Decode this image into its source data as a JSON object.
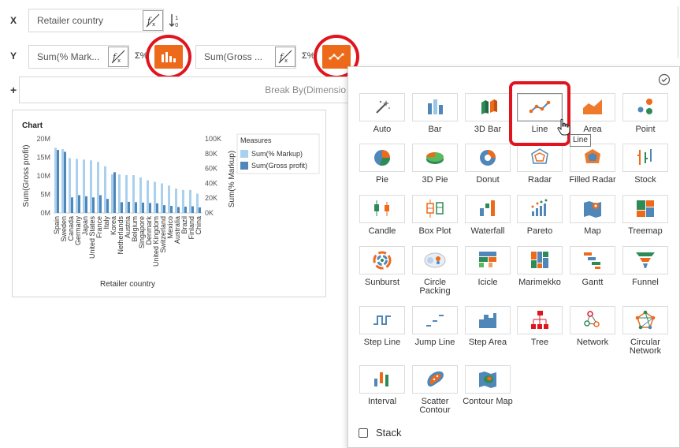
{
  "shelf": {
    "x_label": "X",
    "y_label": "Y",
    "plus_label": "+",
    "x_field": "Retailer country",
    "y_field_1": "Sum(% Mark...",
    "y_field_2": "Sum(Gross ...",
    "break_by_placeholder": "Break By(Dimensio",
    "sigma_label": "Σ%"
  },
  "chart": {
    "title": "Chart",
    "xlabel": "Retailer country",
    "legend_title": "Measures"
  },
  "chart_data": {
    "type": "bar",
    "title": "Chart",
    "xlabel": "Retailer country",
    "ylabel": "Sum(Gross profit)",
    "y2label": "Sum(% Markup)",
    "categories": [
      "Spain",
      "Sweden",
      "Canada",
      "Germany",
      "Japan",
      "United States",
      "France",
      "Italy",
      "Korea",
      "Netherlands",
      "Austria",
      "Belgium",
      "Singapore",
      "Denmark",
      "United Kingdom",
      "Switzerland",
      "Mexico",
      "Australia",
      "Brazil",
      "Finland",
      "China"
    ],
    "series": [
      {
        "name": "Sum(% Markup)",
        "axis": "right",
        "color": "#a9d1ef",
        "values": [
          88000,
          86000,
          74000,
          73000,
          72000,
          71000,
          69000,
          63000,
          52000,
          52000,
          51000,
          51000,
          48000,
          44000,
          42000,
          40000,
          37000,
          33000,
          31000,
          31000,
          26000
        ]
      },
      {
        "name": "Sum(Gross profit)",
        "axis": "left",
        "color": "#4f87b8",
        "values": [
          17000000,
          16500000,
          4200000,
          4800000,
          4500000,
          4200000,
          4800000,
          3800000,
          11000000,
          2900000,
          3000000,
          2900000,
          2800000,
          2700000,
          2600000,
          2100000,
          1900000,
          1600000,
          1700000,
          1800000,
          1500000
        ]
      }
    ],
    "ylim": [
      0,
      20000000
    ],
    "y_ticks": [
      "0M",
      "5M",
      "10M",
      "15M",
      "20M"
    ],
    "y2lim": [
      0,
      100000
    ],
    "y2_ticks": [
      "0K",
      "20K",
      "40K",
      "60K",
      "80K",
      "100K"
    ],
    "legend": "right",
    "grid": false
  },
  "picker": {
    "stack_label": "Stack",
    "tooltip": "Line",
    "charts": [
      {
        "label": "Auto",
        "icon": "magic-wand-icon"
      },
      {
        "label": "Bar",
        "icon": "bar-chart-icon"
      },
      {
        "label": "3D Bar",
        "icon": "bar-3d-icon"
      },
      {
        "label": "Line",
        "icon": "line-chart-icon"
      },
      {
        "label": "Area",
        "icon": "area-chart-icon"
      },
      {
        "label": "Point",
        "icon": "point-chart-icon"
      },
      {
        "label": "Pie",
        "icon": "pie-chart-icon"
      },
      {
        "label": "3D Pie",
        "icon": "pie-3d-icon"
      },
      {
        "label": "Donut",
        "icon": "donut-chart-icon"
      },
      {
        "label": "Radar",
        "icon": "radar-chart-icon"
      },
      {
        "label": "Filled Radar",
        "icon": "filled-radar-icon"
      },
      {
        "label": "Stock",
        "icon": "stock-chart-icon"
      },
      {
        "label": "Candle",
        "icon": "candle-chart-icon"
      },
      {
        "label": "Box Plot",
        "icon": "box-plot-icon"
      },
      {
        "label": "Waterfall",
        "icon": "waterfall-chart-icon"
      },
      {
        "label": "Pareto",
        "icon": "pareto-chart-icon"
      },
      {
        "label": "Map",
        "icon": "map-icon"
      },
      {
        "label": "Treemap",
        "icon": "treemap-icon"
      },
      {
        "label": "Sunburst",
        "icon": "sunburst-icon"
      },
      {
        "label": "Circle Packing",
        "icon": "circle-packing-icon"
      },
      {
        "label": "Icicle",
        "icon": "icicle-icon"
      },
      {
        "label": "Marimekko",
        "icon": "marimekko-icon"
      },
      {
        "label": "Gantt",
        "icon": "gantt-icon"
      },
      {
        "label": "Funnel",
        "icon": "funnel-icon"
      },
      {
        "label": "Step Line",
        "icon": "step-line-icon"
      },
      {
        "label": "Jump Line",
        "icon": "jump-line-icon"
      },
      {
        "label": "Step Area",
        "icon": "step-area-icon"
      },
      {
        "label": "Tree",
        "icon": "tree-chart-icon"
      },
      {
        "label": "Network",
        "icon": "network-chart-icon"
      },
      {
        "label": "Circular Network",
        "icon": "circular-network-icon"
      },
      {
        "label": "Interval",
        "icon": "interval-chart-icon"
      },
      {
        "label": "Scatter Contour",
        "icon": "scatter-contour-icon"
      },
      {
        "label": "Contour Map",
        "icon": "contour-map-icon"
      }
    ]
  },
  "colors": {
    "accent": "#ee6a1b",
    "highlight_ring": "#e0141e",
    "bar_light": "#a9d1ef",
    "bar_dark": "#4f87b8"
  }
}
